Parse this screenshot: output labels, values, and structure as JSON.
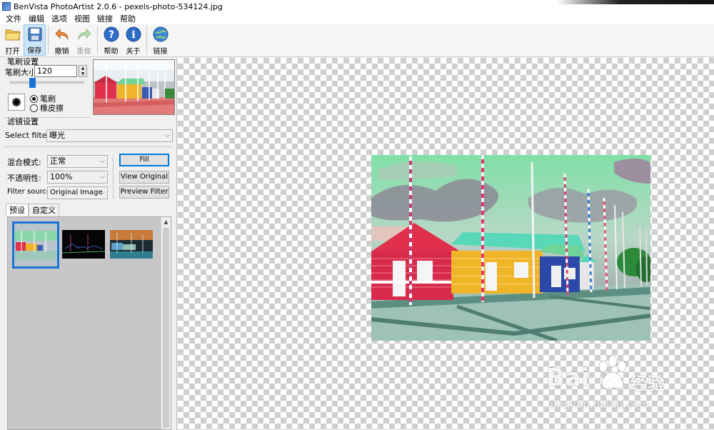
{
  "window": {
    "title": "BenVista PhotoArtist 2.0.6 - pexels-photo-534124.jpg"
  },
  "menu": [
    "文件",
    "编辑",
    "选项",
    "视图",
    "链接",
    "帮助"
  ],
  "toolbar": {
    "open": "打开",
    "save": "保存",
    "undo": "撤销",
    "redo": "重做",
    "help": "帮助",
    "about": "关于",
    "link": "链接"
  },
  "brush": {
    "group_label": "笔刷设置",
    "size_label": "笔刷大小:",
    "size_value": "120",
    "mode_brush": "笔刷",
    "mode_eraser": "橡皮擦",
    "selected_mode": "brush"
  },
  "filter": {
    "group_label": "滤镜设置",
    "select_label": "Select filter:",
    "selected_filter": "曝光",
    "blend_label": "混合模式:",
    "blend_value": "正常",
    "opacity_label": "不透明性:",
    "opacity_value": "100%",
    "source_label": "Filter source:",
    "source_value": "Original Image",
    "fill_button": "Fill",
    "view_original_button": "View Original",
    "preview_filter_button": "Preview Filter"
  },
  "tabs": {
    "presets": "预设",
    "custom": "自定义",
    "active": "presets"
  },
  "watermark": {
    "brand": "Bai",
    "brand_cn": "经验",
    "url": "jingyan.baidu.com"
  },
  "colors": {
    "accent": "#1a73d9",
    "sky_green": "#6fd39a",
    "house_red": "#e0304c",
    "house_yellow": "#f0b428",
    "ground": "#8fb7aa"
  }
}
